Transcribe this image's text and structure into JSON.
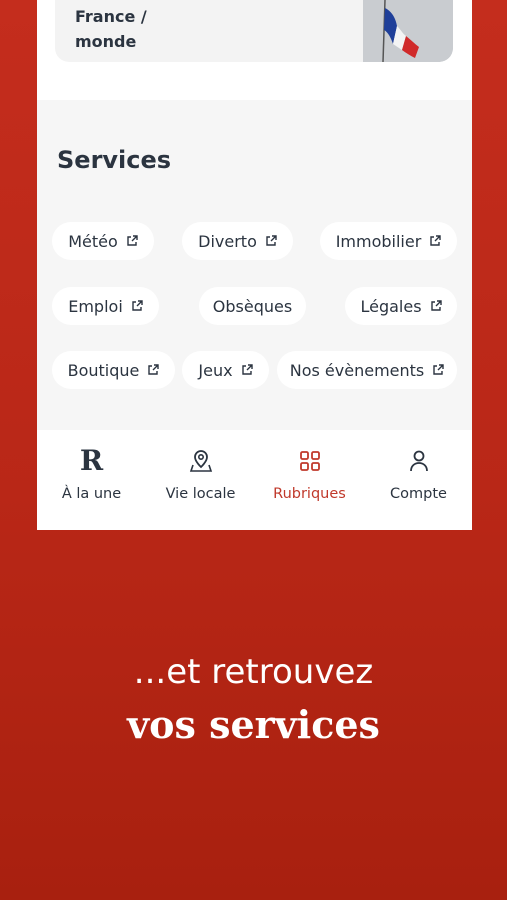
{
  "article_card": {
    "title": "France / monde"
  },
  "services": {
    "heading": "Services",
    "chips": [
      {
        "label": "Météo",
        "external": true
      },
      {
        "label": "Diverto",
        "external": true
      },
      {
        "label": "Immobilier",
        "external": true
      },
      {
        "label": "Emploi",
        "external": true
      },
      {
        "label": "Obsèques",
        "external": false
      },
      {
        "label": "Légales",
        "external": true
      },
      {
        "label": "Boutique",
        "external": true
      },
      {
        "label": "Jeux",
        "external": true
      },
      {
        "label": "Nos évènements",
        "external": true
      }
    ]
  },
  "tabbar": {
    "tabs": [
      {
        "label": "À la une",
        "icon": "r-logo-icon",
        "logo_text": "R",
        "active": false
      },
      {
        "label": "Vie locale",
        "icon": "map-pin-icon",
        "active": false
      },
      {
        "label": "Rubriques",
        "icon": "grid-icon",
        "active": true
      },
      {
        "label": "Compte",
        "icon": "user-icon",
        "active": false
      }
    ]
  },
  "promo": {
    "line1": "...et retrouvez",
    "line2": "vos services"
  },
  "colors": {
    "brand_red": "#c0392b",
    "background_red": "#b92717",
    "text_dark": "#2b3440"
  }
}
